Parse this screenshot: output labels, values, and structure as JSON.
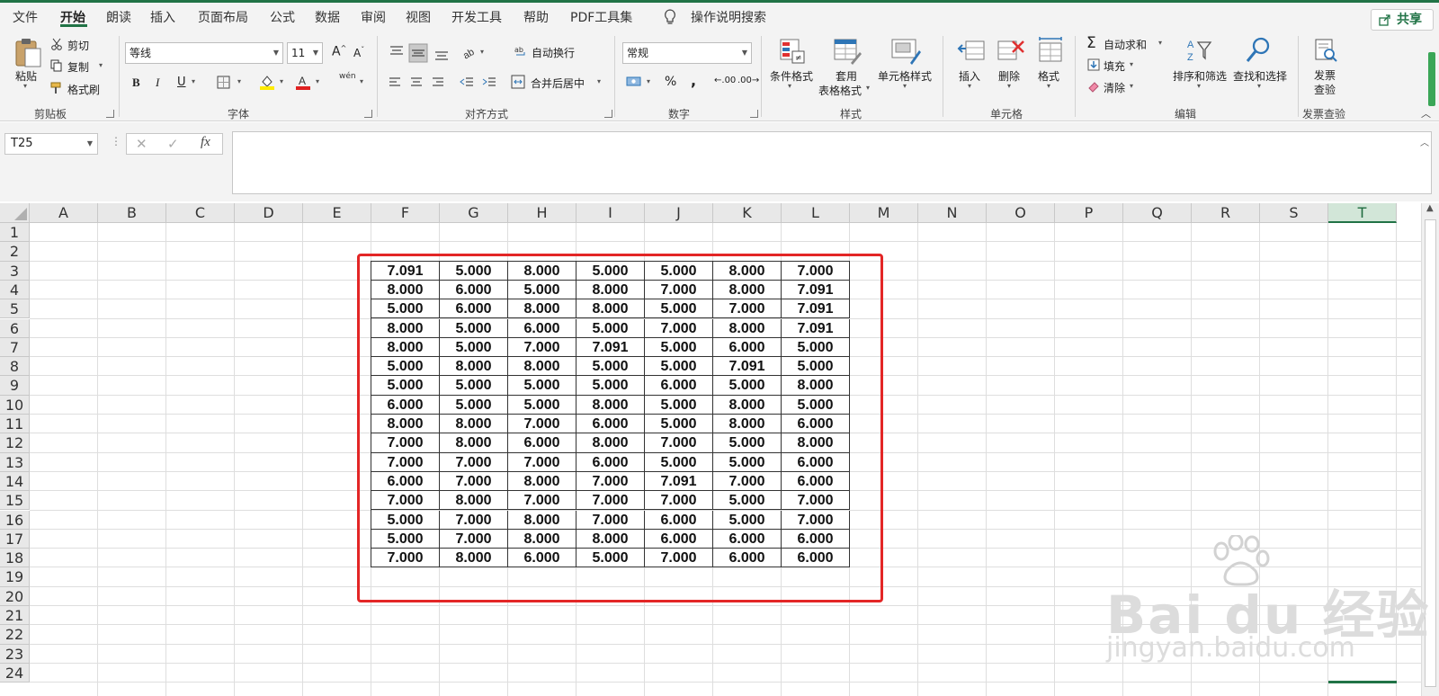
{
  "menu": {
    "tabs": [
      "文件",
      "开始",
      "朗读",
      "插入",
      "页面布局",
      "公式",
      "数据",
      "审阅",
      "视图",
      "开发工具",
      "帮助",
      "PDF工具集"
    ],
    "search": "操作说明搜索",
    "share": "共享"
  },
  "ribbon": {
    "clipboard": {
      "paste": "粘贴",
      "cut": "剪切",
      "copy": "复制",
      "format_painter": "格式刷",
      "group": "剪贴板"
    },
    "font": {
      "name": "等线",
      "size": "11",
      "bold": "B",
      "italic": "I",
      "underline": "U",
      "group": "字体",
      "grow": "A",
      "shrink": "A",
      "phonetic": "wén"
    },
    "alignment": {
      "wrap": "自动换行",
      "merge": "合并后居中",
      "group": "对齐方式"
    },
    "number": {
      "format": "常规",
      "percent": "%",
      "comma": ",",
      "group": "数字",
      "inc_decimal": ".00",
      "dec_decimal": ".00"
    },
    "styles": {
      "conditional": "条件格式",
      "table_1": "套用",
      "table_2": "表格格式",
      "cell_styles": "单元格样式",
      "group": "样式"
    },
    "cells": {
      "insert": "插入",
      "delete": "删除",
      "format": "格式",
      "group": "单元格"
    },
    "editing": {
      "autosum": "自动求和",
      "fill": "填充",
      "clear": "清除",
      "sort_filter": "排序和筛选",
      "find_select": "查找和选择",
      "group": "编辑"
    },
    "invoice": {
      "check_1": "发票",
      "check_2": "查验",
      "group": "发票查验"
    }
  },
  "formula_bar": {
    "name_box": "T25",
    "fx": "fx",
    "value": ""
  },
  "sheet": {
    "columns": [
      "A",
      "B",
      "C",
      "D",
      "E",
      "F",
      "G",
      "H",
      "I",
      "J",
      "K",
      "L",
      "M",
      "N",
      "O",
      "P",
      "Q",
      "R",
      "S",
      "T"
    ],
    "selected_column": "T",
    "rows": [
      "1",
      "2",
      "3",
      "4",
      "5",
      "6",
      "7",
      "8",
      "9",
      "10",
      "11",
      "12",
      "13",
      "14",
      "15",
      "16",
      "17",
      "18",
      "19",
      "20",
      "21",
      "22",
      "23",
      "24"
    ],
    "table": [
      [
        "7.091",
        "5.000",
        "8.000",
        "5.000",
        "5.000",
        "8.000",
        "7.000"
      ],
      [
        "8.000",
        "6.000",
        "5.000",
        "8.000",
        "7.000",
        "8.000",
        "7.091"
      ],
      [
        "5.000",
        "6.000",
        "8.000",
        "8.000",
        "5.000",
        "7.000",
        "7.091"
      ],
      [
        "8.000",
        "5.000",
        "6.000",
        "5.000",
        "7.000",
        "8.000",
        "7.091"
      ],
      [
        "8.000",
        "5.000",
        "7.000",
        "7.091",
        "5.000",
        "6.000",
        "5.000"
      ],
      [
        "5.000",
        "8.000",
        "8.000",
        "5.000",
        "5.000",
        "7.091",
        "5.000"
      ],
      [
        "5.000",
        "5.000",
        "5.000",
        "5.000",
        "6.000",
        "5.000",
        "8.000"
      ],
      [
        "6.000",
        "5.000",
        "5.000",
        "8.000",
        "5.000",
        "8.000",
        "5.000"
      ],
      [
        "8.000",
        "8.000",
        "7.000",
        "6.000",
        "5.000",
        "8.000",
        "6.000"
      ],
      [
        "7.000",
        "8.000",
        "6.000",
        "8.000",
        "7.000",
        "5.000",
        "8.000"
      ],
      [
        "7.000",
        "7.000",
        "7.000",
        "6.000",
        "5.000",
        "5.000",
        "6.000"
      ],
      [
        "6.000",
        "7.000",
        "8.000",
        "7.000",
        "7.091",
        "7.000",
        "6.000"
      ],
      [
        "7.000",
        "8.000",
        "7.000",
        "7.000",
        "7.000",
        "5.000",
        "7.000"
      ],
      [
        "5.000",
        "7.000",
        "8.000",
        "7.000",
        "6.000",
        "5.000",
        "7.000"
      ],
      [
        "5.000",
        "7.000",
        "8.000",
        "8.000",
        "6.000",
        "6.000",
        "6.000"
      ],
      [
        "7.000",
        "8.000",
        "6.000",
        "5.000",
        "7.000",
        "6.000",
        "6.000"
      ]
    ]
  },
  "watermark": {
    "brand": "Bai du 经验",
    "url": "jingyan.baidu.com"
  }
}
